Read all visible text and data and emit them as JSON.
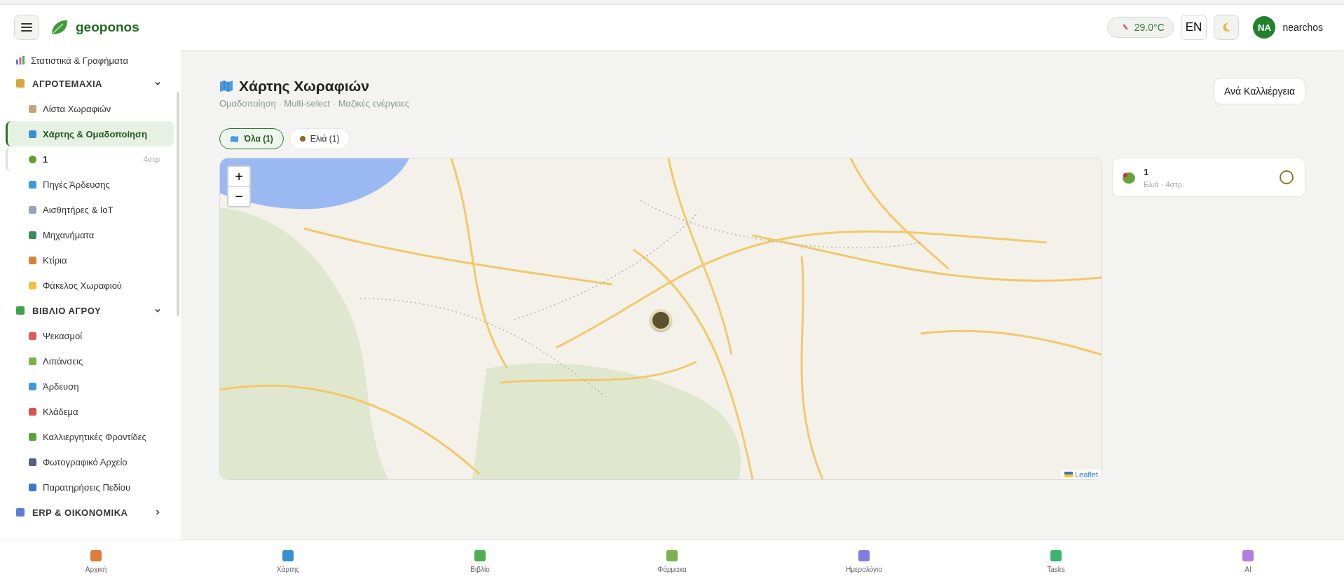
{
  "header": {
    "brand": "geoponos",
    "temperature": "29.0°C",
    "language": "EN",
    "user": {
      "initials": "NA",
      "name": "nearchos"
    }
  },
  "sidebar": {
    "top_item": {
      "label": "Στατιστικά & Γραφήματα"
    },
    "groups": [
      {
        "title": "ΑΓΡΟΤΕΜΑΧΙΑ",
        "expanded": true,
        "items": [
          {
            "kind": "link",
            "label": "Λίστα Χωραφιών",
            "selected": false
          },
          {
            "kind": "link",
            "label": "Χάρτης & Ομαδοποίηση",
            "selected": true
          },
          {
            "kind": "field",
            "label": "1",
            "area": "4στρ",
            "selected": false
          },
          {
            "kind": "link",
            "label": "Πηγές Άρδευσης",
            "selected": false
          },
          {
            "kind": "link",
            "label": "Αισθητήρες & IoT",
            "selected": false
          },
          {
            "kind": "link",
            "label": "Μηχανήματα",
            "selected": false
          },
          {
            "kind": "link",
            "label": "Κτίρια",
            "selected": false
          },
          {
            "kind": "link",
            "label": "Φάκελος Χωραφιού",
            "selected": false
          }
        ]
      },
      {
        "title": "ΒΙΒΛΙΟ ΑΓΡΟΥ",
        "expanded": true,
        "items": [
          {
            "kind": "link",
            "label": "Ψεκασμοί",
            "selected": false
          },
          {
            "kind": "link",
            "label": "Λιπάνσεις",
            "selected": false
          },
          {
            "kind": "link",
            "label": "Άρδευση",
            "selected": false
          },
          {
            "kind": "link",
            "label": "Κλάδεμα",
            "selected": false
          },
          {
            "kind": "link",
            "label": "Καλλιεργητικές Φροντίδες",
            "selected": false
          },
          {
            "kind": "link",
            "label": "Φωτογραφικό Αρχείο",
            "selected": false
          },
          {
            "kind": "link",
            "label": "Παρατηρήσεις Πεδίου",
            "selected": false
          }
        ]
      },
      {
        "title": "ERP & ΟΙΚΟΝΟΜΙΚΑ",
        "expanded": false
      }
    ]
  },
  "page": {
    "title": "Χάρτης Χωραφιών",
    "subtitle": "Ομαδοποίηση · Multi-select · Μαζικές ενέργειες",
    "action": "Ανά Καλλιέργεια",
    "filters": [
      {
        "label": "Όλα (1)",
        "selected": true
      },
      {
        "label": "Ελιά (1)",
        "selected": false,
        "color": "#8a6d1e"
      }
    ],
    "map": {
      "zoom_in": "+",
      "zoom_out": "−",
      "attribution": "Leaflet"
    },
    "fields": [
      {
        "name": "1",
        "meta": "Ελιά · 4στρ.",
        "selected": false
      }
    ]
  },
  "bottom_nav": [
    {
      "label": "Αρχική"
    },
    {
      "label": "Χάρτης"
    },
    {
      "label": "Βιβλίο"
    },
    {
      "label": "Φάρμακα"
    },
    {
      "label": "Ημερολόγιο"
    },
    {
      "label": "Tasks"
    },
    {
      "label": "AI"
    }
  ]
}
